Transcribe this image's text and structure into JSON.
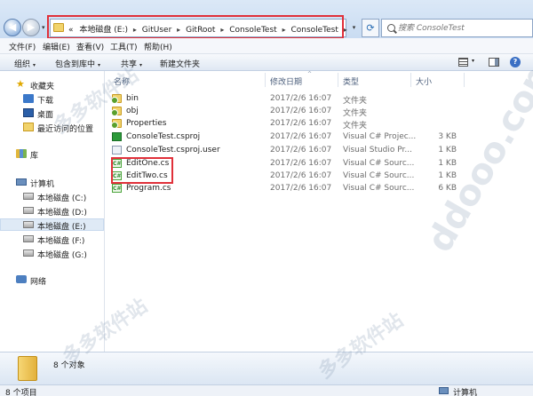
{
  "address": {
    "history_prefix": "«",
    "crumbs": [
      "本地磁盘 (E:)",
      "GitUser",
      "GitRoot",
      "ConsoleTest",
      "ConsoleTest"
    ],
    "crumb_separator": "▸",
    "dropdown_glyph": "▾",
    "refresh_glyph": "⟳"
  },
  "search": {
    "placeholder": "搜索 ConsoleTest"
  },
  "nav_buttons": {
    "back_glyph": "◀",
    "forward_glyph": "▶",
    "history_glyph": "▾"
  },
  "menu": [
    "文件(F)",
    "编辑(E)",
    "查看(V)",
    "工具(T)",
    "帮助(H)"
  ],
  "toolbar": {
    "organize": "组织",
    "include_in_library": "包含到库中",
    "share": "共享",
    "new_folder": "新建文件夹",
    "dropdown_glyph": "▾",
    "help_glyph": "?"
  },
  "nav_pane": {
    "favorites": {
      "label": "收藏夹",
      "items": [
        "下载",
        "桌面",
        "最近访问的位置"
      ]
    },
    "libraries": {
      "label": "库"
    },
    "computer": {
      "label": "计算机",
      "drives": [
        "本地磁盘 (C:)",
        "本地磁盘 (D:)",
        "本地磁盘 (E:)",
        "本地磁盘 (F:)",
        "本地磁盘 (G:)"
      ],
      "selected_drive": "本地磁盘 (E:)"
    },
    "network": {
      "label": "网络"
    }
  },
  "file_list": {
    "columns": {
      "name": "名称",
      "date": "修改日期",
      "type": "类型",
      "size": "大小"
    },
    "sort_glyph": "^",
    "rows": [
      {
        "name": "bin",
        "date": "2017/2/6 16:07",
        "type": "文件夹",
        "size": "",
        "icon": "folder-icon"
      },
      {
        "name": "obj",
        "date": "2017/2/6 16:07",
        "type": "文件夹",
        "size": "",
        "icon": "folder-icon"
      },
      {
        "name": "Properties",
        "date": "2017/2/6 16:07",
        "type": "文件夹",
        "size": "",
        "icon": "folder-icon"
      },
      {
        "name": "ConsoleTest.csproj",
        "date": "2017/2/6 16:07",
        "type": "Visual C# Projec...",
        "size": "3 KB",
        "icon": "csproj-icon"
      },
      {
        "name": "ConsoleTest.csproj.user",
        "date": "2017/2/6 16:07",
        "type": "Visual Studio Pr...",
        "size": "1 KB",
        "icon": "user-file-icon"
      },
      {
        "name": "EditOne.cs",
        "date": "2017/2/6 16:07",
        "type": "Visual C# Sourc...",
        "size": "1 KB",
        "icon": "cs-file-icon"
      },
      {
        "name": "EditTwo.cs",
        "date": "2017/2/6 16:07",
        "type": "Visual C# Sourc...",
        "size": "1 KB",
        "icon": "cs-file-icon"
      },
      {
        "name": "Program.cs",
        "date": "2017/2/6 16:07",
        "type": "Visual C# Sourc...",
        "size": "6 KB",
        "icon": "cs-file-icon"
      }
    ]
  },
  "details_pane": {
    "count_text": "8 个对象"
  },
  "status_bar": {
    "count_text": "8 个项目",
    "location": "计算机"
  },
  "watermark": {
    "text_cn": "多多软件站",
    "text_en": "ddooo.com"
  },
  "colors": {
    "highlight_box": "#e0303a",
    "selection": "#dfeaf6",
    "header_text": "#4c5f7c"
  }
}
